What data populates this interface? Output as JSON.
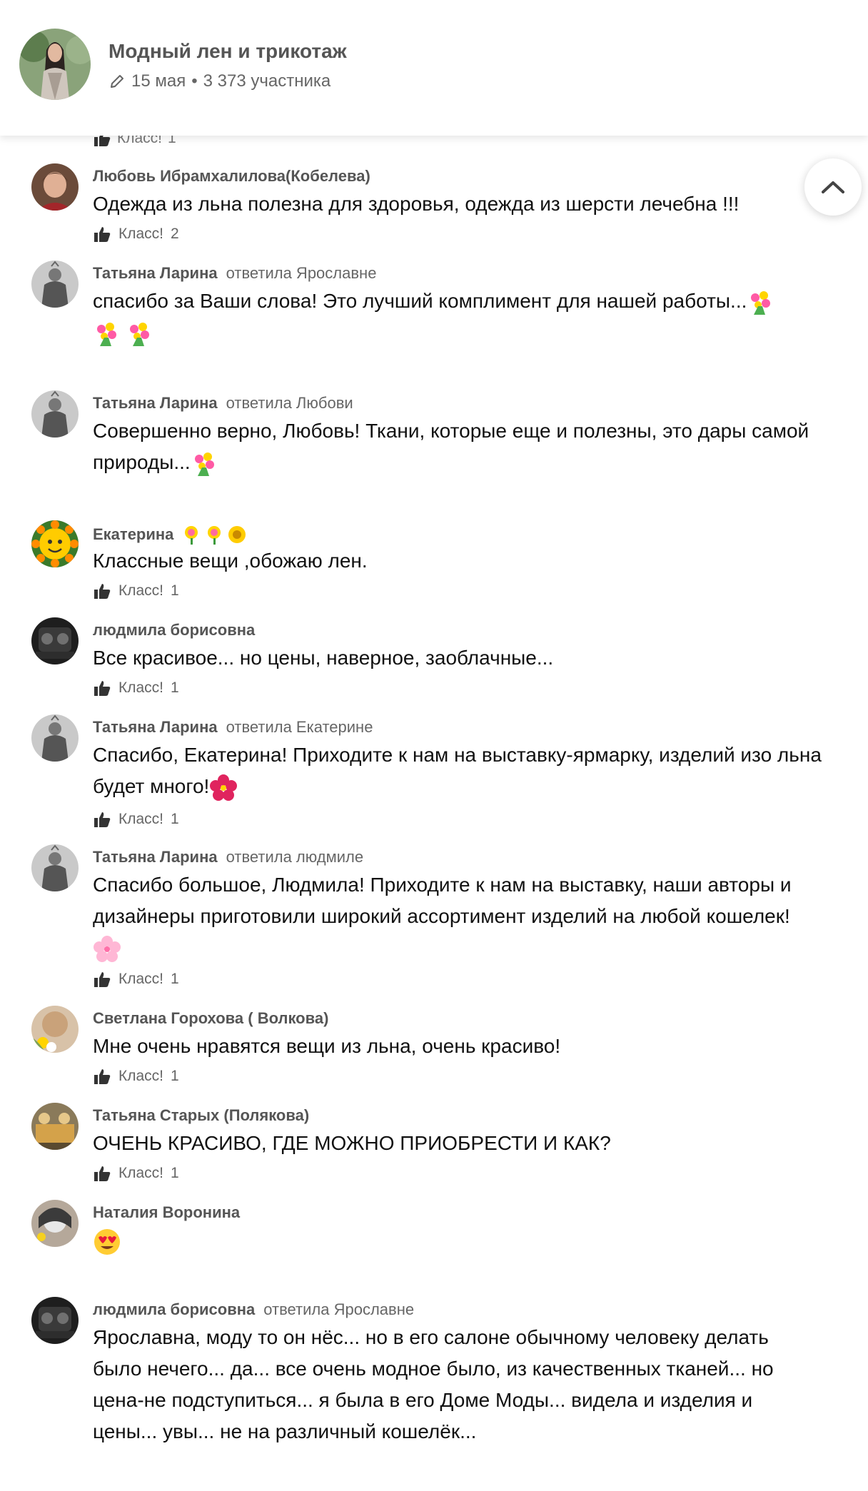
{
  "group": {
    "title": "Модный лен и трикотаж",
    "date": "15 мая",
    "members": "3 373 участника",
    "separator": "•"
  },
  "like_label": "Класс!",
  "cut_like_count": "1",
  "comments": [
    {
      "author": "Любовь Ибрамхалилова(Кобелева)",
      "reply": "",
      "text": "Одежда из льна полезна для здоровья, одежда из шерсти лечебна !!!",
      "likes": "2"
    },
    {
      "author": "Татьяна Ларина",
      "reply": "ответила Ярославне",
      "text": "спасибо за Ваши слова! Это лучший комплимент для нашей работы...",
      "emoji": [
        "bouquet",
        "bouquet",
        "bouquet"
      ],
      "likes": ""
    },
    {
      "author": "Татьяна Ларина",
      "reply": "ответила Любови",
      "text": "Совершенно верно, Любовь! Ткани, которые еще и полезны, это дары самой природы...",
      "emoji": [
        "bouquet"
      ],
      "likes": ""
    },
    {
      "author": "Екатерина",
      "author_emoji": [
        "tulip-flower",
        "tulip-flower",
        "sunflower"
      ],
      "reply": "",
      "text": "Классные вещи ,обожаю лен.",
      "likes": "1"
    },
    {
      "author": "людмила борисовна",
      "reply": "",
      "text": "Все красивое... но цены, наверное, заоблачные...",
      "likes": "1"
    },
    {
      "author": "Татьяна Ларина",
      "reply": "ответила Екатерине",
      "text": "Спасибо, Екатерина! Приходите к нам на выставку-ярмарку, изделий изо льна будет много!",
      "emoji": [
        "hibiscus"
      ],
      "likes": "1"
    },
    {
      "author": "Татьяна Ларина",
      "reply": "ответила людмиле",
      "text": "Спасибо большое, Людмила! Приходите к нам на выставку, наши авторы и дизайнеры приготовили широкий ассортимент изделий на любой кошелек!",
      "emoji": [
        "cherry-blossom"
      ],
      "likes": "1"
    },
    {
      "author": "Светлана Горохова ( Волкова)",
      "reply": "",
      "text": "Мне очень нравятся вещи из льна, очень красиво!",
      "likes": "1"
    },
    {
      "author": "Татьяна Старых (Полякова)",
      "reply": "",
      "text": "ОЧЕНЬ КРАСИВО, ГДЕ МОЖНО ПРИОБРЕСТИ И КАК?",
      "likes": "1"
    },
    {
      "author": "Наталия Воронина",
      "reply": "",
      "text": "",
      "emoji": [
        "heart-eyes"
      ],
      "likes": ""
    },
    {
      "author": "людмила борисовна",
      "reply": "ответила Ярославне",
      "text": "Ярославна, моду то он нёс... но в его салоне обычному человеку делать было нечего... да... все очень модное было, из качественных тканей... но цена-не подступиться... я была в его Доме Моды... видела и изделия и цены... увы... не на различный кошелёк...",
      "likes": ""
    }
  ]
}
